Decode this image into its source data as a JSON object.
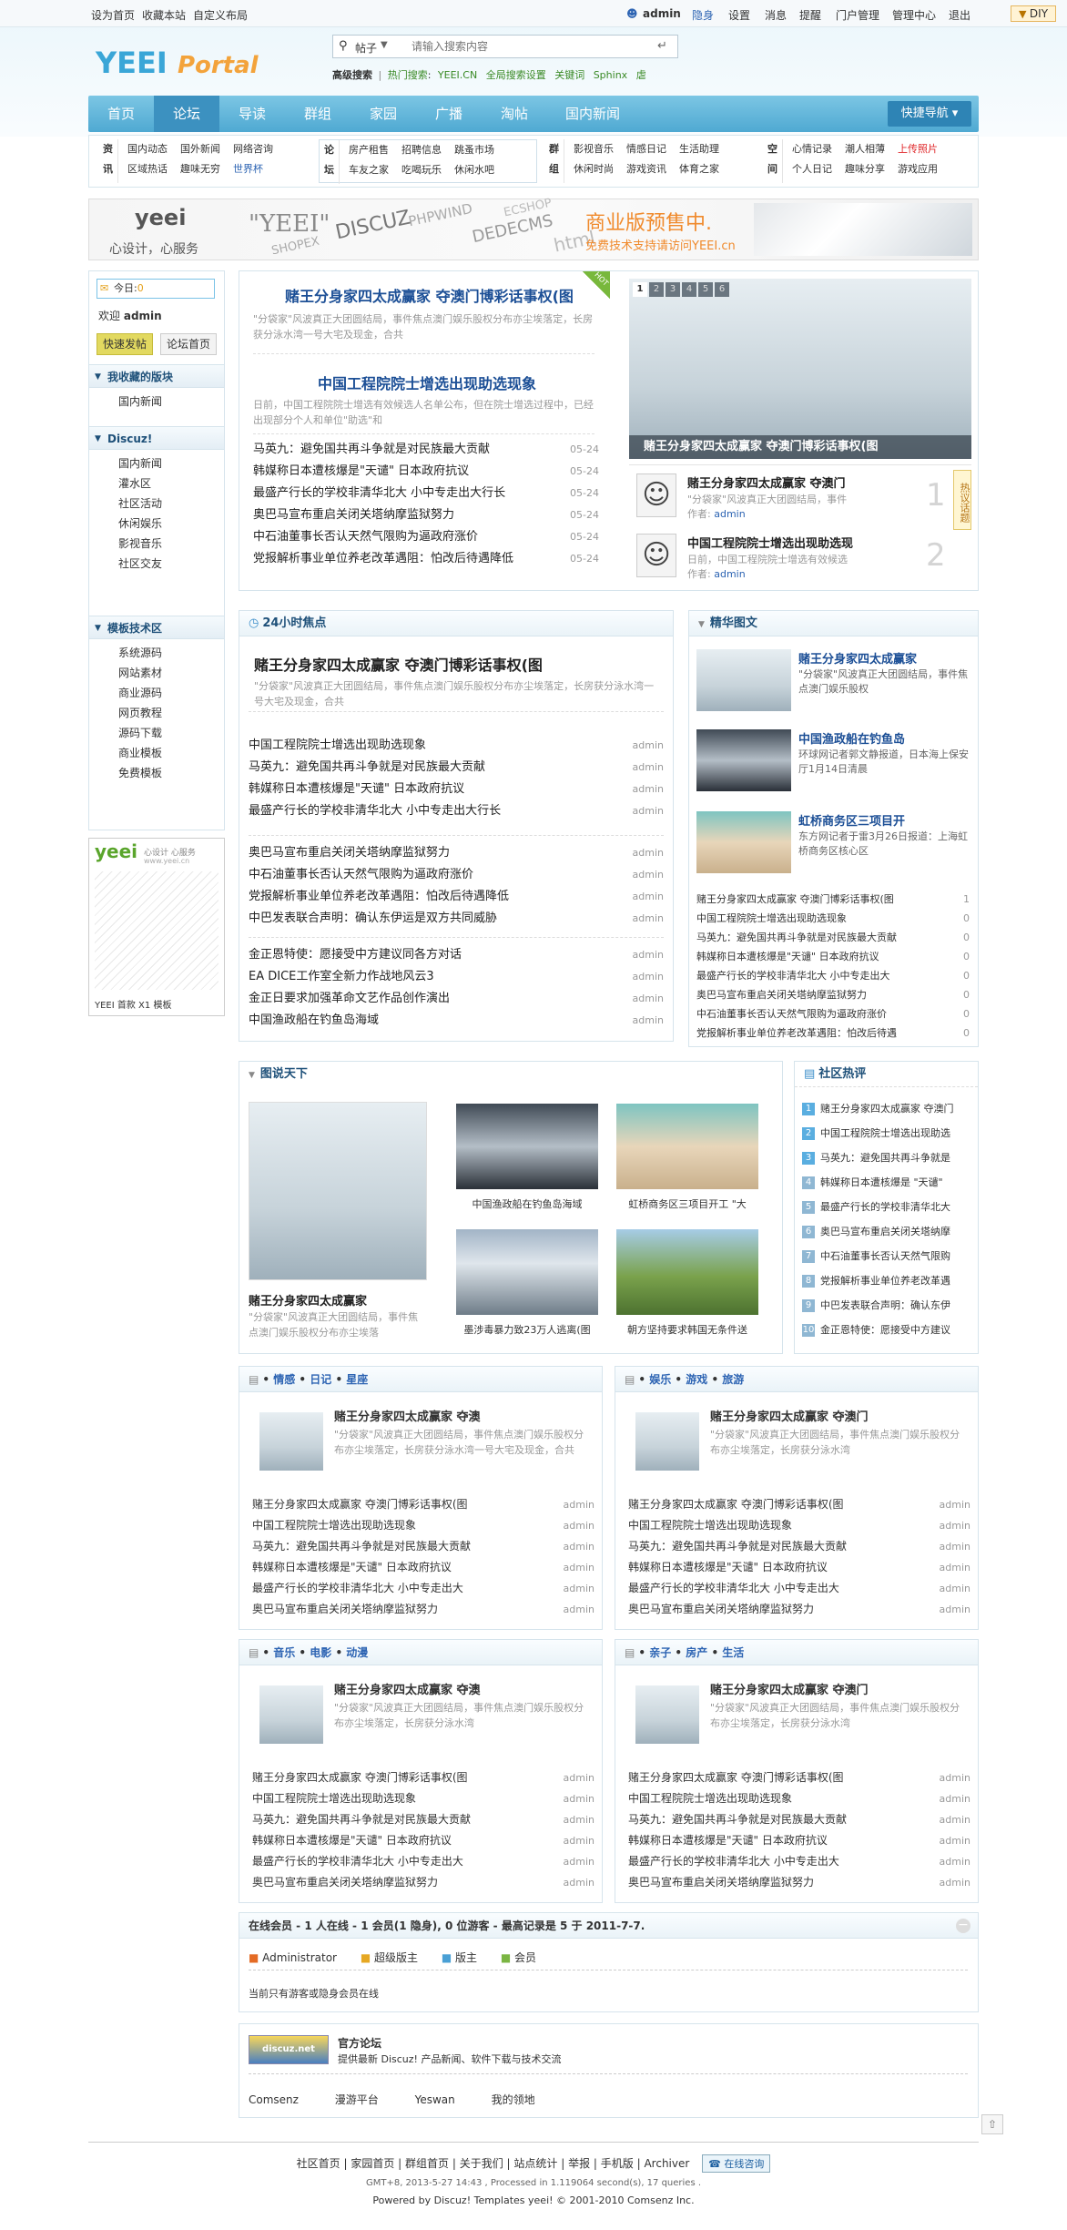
{
  "topbar": {
    "links": [
      "设为首页",
      "收藏本站",
      "自定义布局"
    ],
    "user": "admin",
    "user_links": [
      "隐身",
      "设置",
      "消息",
      "提醒",
      "门户管理",
      "管理中心",
      "退出"
    ],
    "diy": "DIY"
  },
  "logo": {
    "part1": "YEEI",
    "part2": "Portal"
  },
  "search": {
    "type": "帖子",
    "placeholder": "请输入搜索内容",
    "adv": "高级搜索",
    "hot_label": "热门搜索",
    "hot": [
      "YEEI.CN",
      "全局搜索设置",
      "关键词",
      "Sphinx",
      "虐"
    ]
  },
  "nav": {
    "items": [
      "首页",
      "论坛",
      "导读",
      "群组",
      "家园",
      "广播",
      "淘帖",
      "国内新闻"
    ],
    "quick": "快捷导航"
  },
  "subnav": {
    "groups": [
      {
        "label": "资讯",
        "links": [
          "国内动态",
          "国外新闻",
          "网络咨询",
          "区域热话",
          "趣味无穷",
          "世界杯"
        ]
      },
      {
        "label": "论坛",
        "links": [
          "房产租售",
          "招聘信息",
          "跳蚤市场",
          "车友之家",
          "吃喝玩乐",
          "休闲水吧"
        ]
      },
      {
        "label": "群组",
        "links": [
          "影视音乐",
          "情感日记",
          "生活助理",
          "休闲时尚",
          "游戏资讯",
          "体育之家"
        ]
      },
      {
        "label": "空间",
        "links": [
          "心情记录",
          "潮人相薄",
          "上传照片",
          "个人日记",
          "趣味分享",
          "游戏应用"
        ]
      }
    ]
  },
  "banner": {
    "brand": "yeei",
    "slogan": "心设计，心服务",
    "words": [
      "\"YEEI\"",
      "SHOPEX",
      "DISCUZ",
      "PHPWIND",
      "DEDECMS",
      "ECSHOP",
      "html"
    ],
    "promo": "商业版预售中.",
    "promo_sub": "免费技术支持请访问YEEI.cn"
  },
  "sidebar": {
    "today_label": "今日:",
    "today_count": "0",
    "welcome": "欢迎",
    "user": "admin",
    "btn_post": "快速发帖",
    "btn_home": "论坛首页",
    "sec1_title": "我收藏的版块",
    "sec1": [
      "国内新闻"
    ],
    "sec2_title": "Discuz!",
    "sec2": [
      "国内新闻",
      "灌水区",
      "社区活动",
      "休闲娱乐",
      "影视音乐",
      "社区交友"
    ],
    "sec3_title": "模板技术区",
    "sec3": [
      "系统源码",
      "网站素材",
      "商业源码",
      "网页教程",
      "源码下载",
      "商业模板",
      "免费模板"
    ],
    "ad_brand": "yeei",
    "ad_text": "心设计 心服务",
    "ad_url": "www.yeei.cn",
    "ad_caption": "YEEI 首款 X1 模板"
  },
  "headline": {
    "hot_tag": "HOT",
    "main_title": "赌王分身家四太成赢家 夺澳门博彩话事权(图",
    "main_desc": "\"分袋家\"风波真正大团圆结局，事件焦点澳门娱乐股权分布亦尘埃落定，长房获分泳水湾一号大宅及现金，合共",
    "sec_title": "中国工程院院士增选出现助选现象",
    "sec_desc": "日前，中国工程院院士增选有效候选人名单公布，但在院士增选过程中，已经出现部分个人和单位\"助选\"和",
    "news": [
      {
        "t": "马英九：避免国共再斗争就是对民族最大贡献",
        "d": "05-24"
      },
      {
        "t": "韩媒称日本遭核爆是\"天谴\" 日本政府抗议",
        "d": "05-24"
      },
      {
        "t": "最盛产行长的学校非清华北大 小中专走出大行长",
        "d": "05-24"
      },
      {
        "t": "奥巴马宣布重启关闭关塔纳摩监狱努力",
        "d": "05-24"
      },
      {
        "t": "中石油董事长否认天然气限购为逼政府涨价",
        "d": "05-24"
      },
      {
        "t": "党报解析事业单位养老改革遇阻：怕改后待遇降低",
        "d": "05-24"
      }
    ]
  },
  "slider": {
    "pages": [
      "1",
      "2",
      "3",
      "4",
      "5",
      "6"
    ],
    "caption": "赌王分身家四太成赢家 夺澳门博彩话事权(图",
    "hot_label": "热议话题",
    "topics": [
      {
        "title": "赌王分身家四太成赢家 夺澳门",
        "desc": "\"分袋家\"风波真正大团圆结局，事件",
        "author_label": "作者:",
        "author": "admin",
        "rank": "1"
      },
      {
        "title": "中国工程院院士增选出现助选现",
        "desc": "日前，中国工程院院士增选有效候选",
        "author_label": "作者:",
        "author": "admin",
        "rank": "2"
      }
    ]
  },
  "focus24": {
    "title": "24小时焦点",
    "lead_title": "赌王分身家四太成赢家 夺澳门博彩话事权(图",
    "lead_desc": "\"分袋家\"风波真正大团圆结局，事件焦点澳门娱乐股权分布亦尘埃落定，长房获分泳水湾一号大宅及现金，合共",
    "groups": [
      [
        {
          "t": "中国工程院院士增选出现助选现象",
          "a": "admin"
        },
        {
          "t": "马英九：避免国共再斗争就是对民族最大贡献",
          "a": "admin"
        },
        {
          "t": "韩媒称日本遭核爆是\"天谴\" 日本政府抗议",
          "a": "admin"
        },
        {
          "t": "最盛产行长的学校非清华北大 小中专走出大行长",
          "a": "admin"
        }
      ],
      [
        {
          "t": "奥巴马宣布重启关闭关塔纳摩监狱努力",
          "a": "admin"
        },
        {
          "t": "中石油董事长否认天然气限购为逼政府涨价",
          "a": "admin"
        },
        {
          "t": "党报解析事业单位养老改革遇阻：怕改后待遇降低",
          "a": "admin"
        },
        {
          "t": "中巴发表联合声明：确认东伊运是双方共同威胁",
          "a": "admin"
        }
      ],
      [
        {
          "t": "金正恩特使：愿接受中方建议同各方对话",
          "a": "admin"
        },
        {
          "t": "EA DICE工作室全新力作战地风云3",
          "a": "admin"
        },
        {
          "t": "金正日要求加强革命文艺作品创作演出",
          "a": "admin"
        },
        {
          "t": "中国渔政船在钓鱼岛海域",
          "a": "admin"
        }
      ]
    ]
  },
  "jinghua": {
    "title": "精华图文",
    "items": [
      {
        "t": "赌王分身家四太成赢家",
        "d": "\"分袋家\"风波真正大团圆结局，事件焦点澳门娱乐股权"
      },
      {
        "t": "中国渔政船在钓鱼岛",
        "d": "环球网记者郭文静报道，日本海上保安厅1月14日清晨"
      },
      {
        "t": "虹桥商务区三项目开",
        "d": "东方网记者于雷3月26日报道：上海虹桥商务区核心区"
      }
    ],
    "list": [
      {
        "t": "赌王分身家四太成赢家 夺澳门博彩话事权(图",
        "n": "1"
      },
      {
        "t": "中国工程院院士增选出现助选现象",
        "n": "0"
      },
      {
        "t": "马英九：避免国共再斗争就是对民族最大贡献",
        "n": "0"
      },
      {
        "t": "韩媒称日本遭核爆是\"天谴\" 日本政府抗议",
        "n": "0"
      },
      {
        "t": "最盛产行长的学校非清华北大 小中专走出大",
        "n": "0"
      },
      {
        "t": "奥巴马宣布重启关闭关塔纳摩监狱努力",
        "n": "0"
      },
      {
        "t": "中石油董事长否认天然气限购为逼政府涨价",
        "n": "0"
      },
      {
        "t": "党报解析事业单位养老改革遇阻：怕改后待遇",
        "n": "0"
      }
    ]
  },
  "tushuo": {
    "title": "图说天下",
    "big_title": "赌王分身家四太成赢家",
    "big_desc": "\"分袋家\"风波真正大团圆结局，事件焦点澳门娱乐股权分布亦尘埃落",
    "thumbs": [
      "中国渔政船在钓鱼岛海域",
      "虹桥商务区三项目开工 \"大",
      "墨涉毒暴力致23万人逃离(图",
      "朝方坚持要求韩国无条件送"
    ]
  },
  "hot": {
    "title": "社区热评",
    "items": [
      "赌王分身家四太成赢家 夺澳门",
      "中国工程院院士增选出现助选",
      "马英九：避免国共再斗争就是",
      "韩媒称日本遭核爆是 \"天谴\"",
      "最盛产行长的学校非清华北大",
      "奥巴马宣布重启关闭关塔纳摩",
      "中石油董事长否认天然气限购",
      "党报解析事业单位养老改革遇",
      "中巴发表联合声明：确认东伊",
      "金正恩特使：愿接受中方建议"
    ],
    "nums": [
      "1",
      "2",
      "3",
      "4",
      "5",
      "6",
      "7",
      "8",
      "9",
      "10"
    ]
  },
  "boxes": [
    {
      "cats": [
        "情感",
        "日记",
        "星座"
      ],
      "lead": "赌王分身家四太成赢家 夺澳",
      "desc": "\"分袋家\"风波真正大团圆结局，事件焦点澳门娱乐股权分布亦尘埃落定，长房获分泳水湾一号大宅及现金，合共"
    },
    {
      "cats": [
        "娱乐",
        "游戏",
        "旅游"
      ],
      "lead": "赌王分身家四太成赢家 夺澳门",
      "desc": "\"分袋家\"风波真正大团圆结局，事件焦点澳门娱乐股权分布亦尘埃落定，长房获分泳水湾"
    },
    {
      "cats": [
        "音乐",
        "电影",
        "动漫"
      ],
      "lead": "赌王分身家四太成赢家 夺澳",
      "desc": "\"分袋家\"风波真正大团圆结局，事件焦点澳门娱乐股权分布亦尘埃落定，长房获分泳水湾"
    },
    {
      "cats": [
        "亲子",
        "房产",
        "生活"
      ],
      "lead": "赌王分身家四太成赢家 夺澳门",
      "desc": "\"分袋家\"风波真正大团圆结局，事件焦点澳门娱乐股权分布亦尘埃落定，长房获分泳水湾"
    }
  ],
  "box_list": [
    {
      "t": "赌王分身家四太成赢家 夺澳门博彩话事权(图",
      "a": "admin"
    },
    {
      "t": "中国工程院院士增选出现助选现象",
      "a": "admin"
    },
    {
      "t": "马英九：避免国共再斗争就是对民族最大贡献",
      "a": "admin"
    },
    {
      "t": "韩媒称日本遭核爆是\"天谴\" 日本政府抗议",
      "a": "admin"
    },
    {
      "t": "最盛产行长的学校非清华北大 小中专走出大",
      "a": "admin"
    },
    {
      "t": "奥巴马宣布重启关闭关塔纳摩监狱努力",
      "a": "admin"
    }
  ],
  "online": {
    "title": "在线会员 - 1 人在线 - 1 会员(1 隐身), 0 位游客 - 最高记录是 5 于 2011-7-7.",
    "legend": [
      "Administrator",
      "超级版主",
      "版主",
      "会员"
    ],
    "note": "当前只有游客或隐身会员在线"
  },
  "links": {
    "title": "官方论坛",
    "desc": "提供最新 Discuz! 产品新闻、软件下载与技术交流",
    "logo": "discuz.net",
    "items": [
      "Comsenz",
      "漫游平台",
      "Yeswan",
      "我的领地"
    ]
  },
  "footer": {
    "links": [
      "社区首页",
      "家园首页",
      "群组首页",
      "关于我们",
      "站点统计",
      "举报",
      "手机版",
      "Archiver"
    ],
    "service": "在线咨询",
    "line1": "GMT+8, 2013-5-27 14:43 , Processed in 1.119064 second(s), 17 queries .",
    "line2": "Powered by Discuz! Templates yeei! © 2001-2010 Comsenz Inc."
  }
}
